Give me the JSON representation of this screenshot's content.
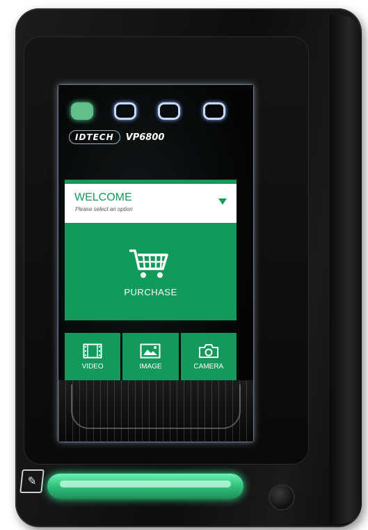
{
  "device": {
    "brand_logo": "IDTECH",
    "model": "VP6800"
  },
  "leds": [
    {
      "state": "active",
      "color": "#63c08d"
    },
    {
      "state": "inactive"
    },
    {
      "state": "inactive"
    },
    {
      "state": "inactive"
    }
  ],
  "welcome": {
    "title": "WELCOME",
    "subtitle": "Please select an option"
  },
  "purchase": {
    "label": "PURCHASE",
    "icon": "shopping-cart-icon"
  },
  "tiles": [
    {
      "label": "VIDEO",
      "icon": "film-icon"
    },
    {
      "label": "IMAGE",
      "icon": "image-icon"
    },
    {
      "label": "CAMERA",
      "icon": "camera-icon"
    }
  ],
  "colors": {
    "accent_green": "#129a5a",
    "card_slot_glow": "#3be59a"
  }
}
